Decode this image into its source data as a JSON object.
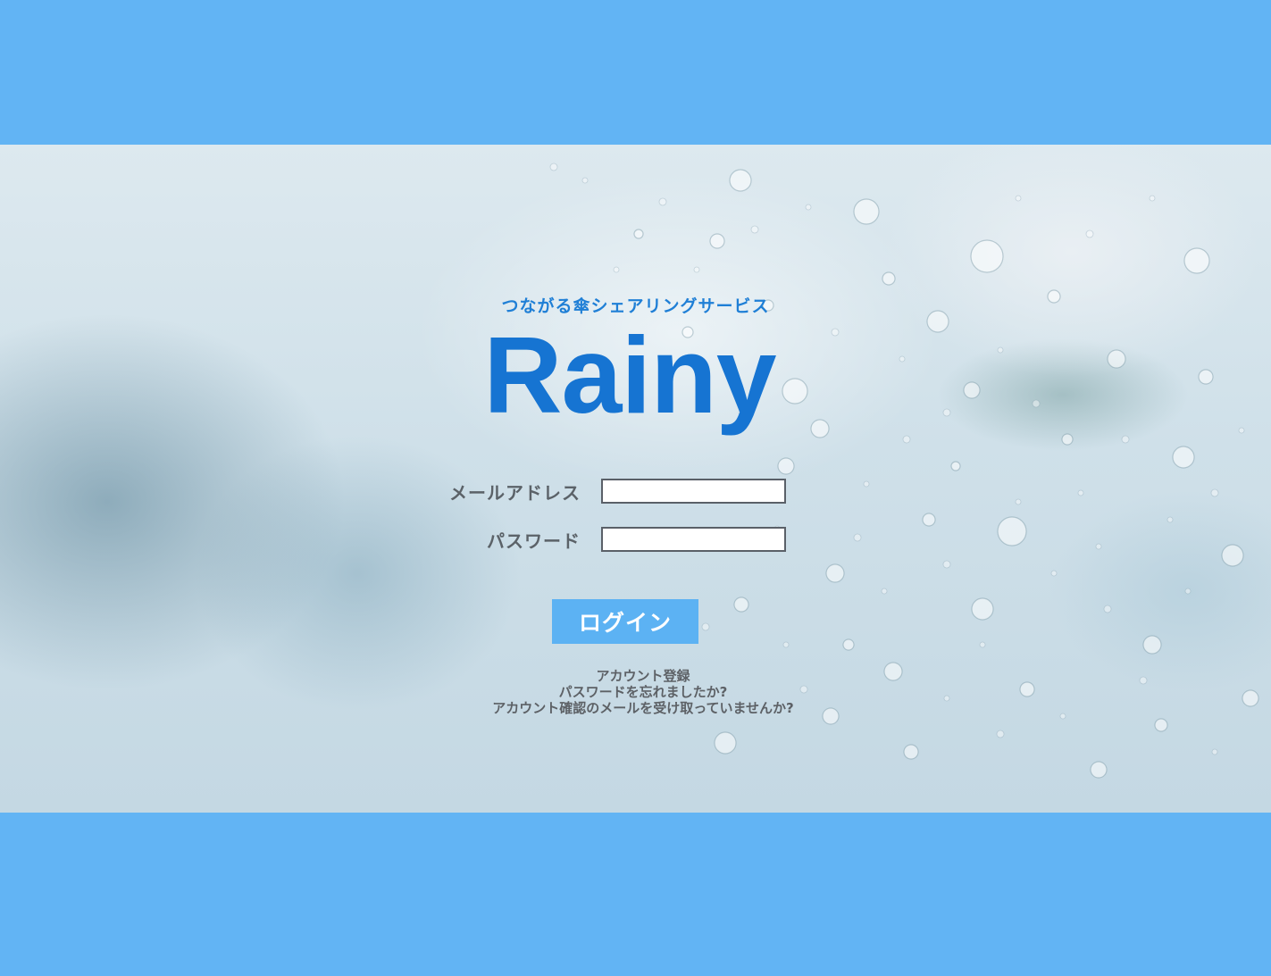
{
  "colors": {
    "band": "#62b4f4",
    "accent": "#1674d2",
    "button": "#5cb2f3",
    "label": "#5b6268"
  },
  "hero": {
    "tagline": "つながる傘シェアリングサービス",
    "logo": "Rainy"
  },
  "form": {
    "email_label": "メールアドレス",
    "email_value": "",
    "password_label": "パスワード",
    "password_value": "",
    "login_label": "ログイン"
  },
  "links": {
    "register": "アカウント登録",
    "forgot_password": "パスワードを忘れましたか?",
    "resend_confirmation": "アカウント確認のメールを受け取っていませんか?"
  }
}
